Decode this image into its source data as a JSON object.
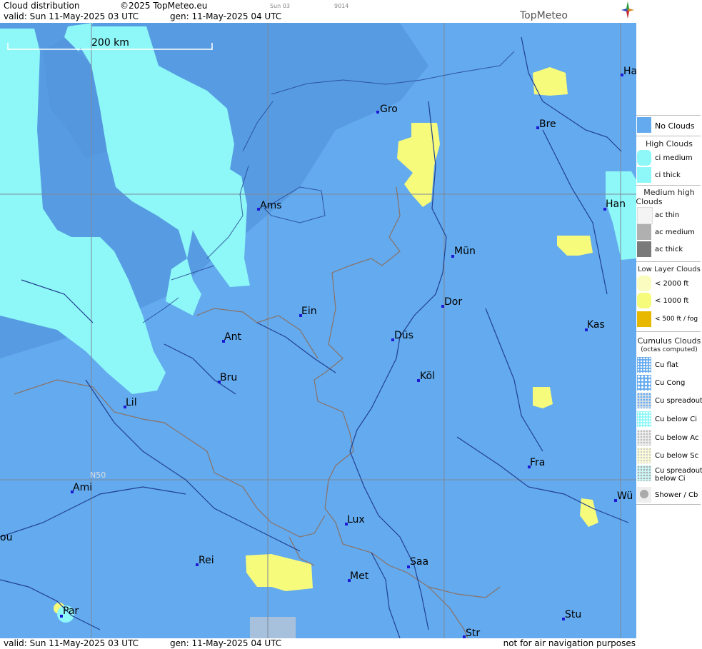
{
  "header": {
    "title": "Cloud distribution",
    "copyright": "©2025 TopMeteo.eu",
    "run_day": "Sun 03",
    "run_code": "9014",
    "valid": "valid:  Sun  11-May-2025  03 UTC",
    "gen": "gen: 11-May-2025 04 UTC",
    "logo": "TopMeteo"
  },
  "footer": {
    "valid": "valid:  Sun  11-May-2025  03 UTC",
    "gen": "gen: 11-May-2025 04 UTC",
    "disclaimer": "not for air navigation purposes"
  },
  "map": {
    "scale_label": "200 km",
    "lat_label": "N50",
    "colors": {
      "no_clouds": "#63aaee",
      "land_dark": "#4f8fd9",
      "ci": "#8ef7f7",
      "low": "#f7fb7c",
      "border": "#8a7268",
      "river": "#22408f",
      "grid": "#7d8a98"
    },
    "cities": [
      {
        "name": "Gro"
      },
      {
        "name": "Bre"
      },
      {
        "name": "Ha"
      },
      {
        "name": "Ams"
      },
      {
        "name": "Han"
      },
      {
        "name": "Mün"
      },
      {
        "name": "Dor"
      },
      {
        "name": "Ein"
      },
      {
        "name": "Kas"
      },
      {
        "name": "Ant"
      },
      {
        "name": "Düs"
      },
      {
        "name": "Köl"
      },
      {
        "name": "Bru"
      },
      {
        "name": "Lil"
      },
      {
        "name": "Fra"
      },
      {
        "name": "Ami"
      },
      {
        "name": "Wü"
      },
      {
        "name": "Lux"
      },
      {
        "name": "ou"
      },
      {
        "name": "Rei"
      },
      {
        "name": "Saa"
      },
      {
        "name": "Met"
      },
      {
        "name": "Par"
      },
      {
        "name": "Stu"
      },
      {
        "name": "Str"
      }
    ]
  },
  "legend": {
    "no_clouds": "No Clouds",
    "high_head": "High Clouds",
    "ci_medium": "ci medium",
    "ci_thick": "ci thick",
    "medium_head_1": "Medium high",
    "medium_head_2": "Clouds",
    "ac_thin": "ac thin",
    "ac_medium": "ac medium",
    "ac_thick": "ac thick",
    "low_head": "Low Layer Clouds",
    "low_2000": "< 2000 ft",
    "low_1000": "< 1000 ft",
    "low_500": "< 500 ft / fog",
    "cu_head": "Cumulus Clouds",
    "cu_sub": "(octas computed)",
    "cu_flat": "Cu flat",
    "cu_cong": "Cu Cong",
    "cu_spreadout": "Cu spreadout",
    "cu_below_ci": "Cu below Ci",
    "cu_below_ac": "Cu below Ac",
    "cu_below_sc": "Cu below Sc",
    "cu_spread_ci_1": "Cu spreadout",
    "cu_spread_ci_2": "below Ci",
    "shower": "Shower / Cb"
  }
}
